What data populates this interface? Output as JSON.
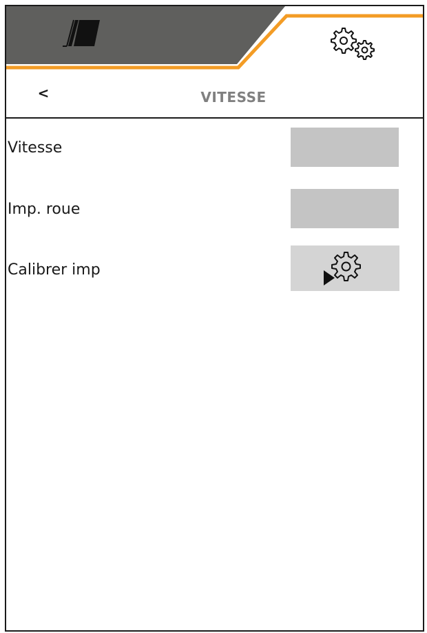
{
  "header": {
    "back_label": "<",
    "title": "VITESSE"
  },
  "tabs": [
    {
      "name": "machine",
      "icon": "machine-icon",
      "active": false
    },
    {
      "name": "settings",
      "icon": "gears-icon",
      "active": true
    }
  ],
  "rows": [
    {
      "label": "Vitesse",
      "value": ""
    },
    {
      "label": "Imp. roue",
      "value": ""
    },
    {
      "label": "Calibrer imp",
      "action_icon": "gear-play-icon"
    }
  ],
  "colors": {
    "tab_inactive_bg": "#5f5f5d",
    "accent": "#f39c25",
    "title_text": "#808080",
    "value_box": "#c4c4c4",
    "button_bg": "#d4d4d4"
  }
}
